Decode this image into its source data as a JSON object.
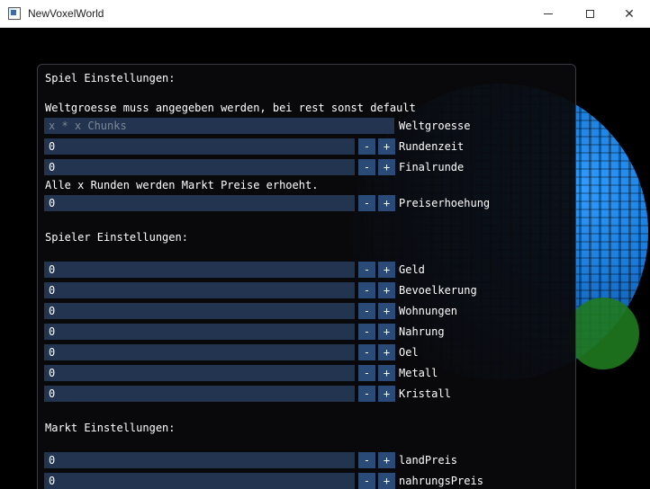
{
  "window": {
    "title": "NewVoxelWorld",
    "min_icon": "minimize-icon",
    "max_icon": "maximize-icon",
    "close_icon": "close-icon"
  },
  "panel": {
    "header": "Spiel Einstellungen:",
    "note": "Weltgroesse muss angegeben werden, bei rest sonst default",
    "world_size": {
      "placeholder": "x * x Chunks",
      "label": "Weltgroesse"
    },
    "round_time": {
      "value": "0",
      "label": "Rundenzeit"
    },
    "final_round": {
      "value": "0",
      "label": "Finalrunde"
    },
    "price_note": "Alle x Runden werden Markt Preise erhoeht.",
    "price_increase": {
      "value": "0",
      "label": "Preiserhoehung"
    },
    "player_header": "Spieler Einstellungen:",
    "player_fields": [
      {
        "value": "0",
        "label": "Geld"
      },
      {
        "value": "0",
        "label": "Bevoelkerung"
      },
      {
        "value": "0",
        "label": "Wohnungen"
      },
      {
        "value": "0",
        "label": "Nahrung"
      },
      {
        "value": "0",
        "label": "Oel"
      },
      {
        "value": "0",
        "label": "Metall"
      },
      {
        "value": "0",
        "label": "Kristall"
      }
    ],
    "market_header": "Markt Einstellungen:",
    "market_fields": [
      {
        "value": "0",
        "label": "landPreis"
      },
      {
        "value": "0",
        "label": "nahrungsPreis"
      }
    ],
    "minus": "-",
    "plus": "+"
  }
}
